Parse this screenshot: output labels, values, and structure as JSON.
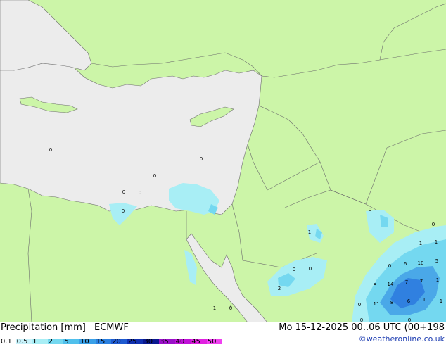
{
  "map": {
    "colors": {
      "sea": "#ececec",
      "land": "#ccf5a8",
      "precip_light": "#a8eef5",
      "precip_medium": "#74d8f0",
      "precip_heavy": "#4aa8e8",
      "precip_max": "#3080e0",
      "borders": "#6c6c6c"
    },
    "labels": [
      "0",
      "0",
      "0",
      "0",
      "0",
      "0",
      "0",
      "0",
      "1",
      "0",
      "0",
      "2",
      "1",
      "1",
      "1",
      "0",
      "0",
      "0",
      "6",
      "10",
      "5",
      "1",
      "8",
      "14",
      "7",
      "7",
      "1",
      "0",
      "11",
      "8",
      "6",
      "1",
      "1",
      "0"
    ]
  },
  "footer": {
    "title": "Precipitation [mm]",
    "model": "ECMWF",
    "valid_time": "Mo 15-12-2025 00..06 UTC (00+198",
    "credit": "©weatheronline.co.uk",
    "scale": [
      {
        "label": "0.1",
        "color": "#fefefe"
      },
      {
        "label": "0.5",
        "color": "#c8f2fa"
      },
      {
        "label": "1",
        "color": "#a8eef5"
      },
      {
        "label": "2",
        "color": "#74d8f0"
      },
      {
        "label": "5",
        "color": "#50c0ec"
      },
      {
        "label": "10",
        "color": "#3aa0e8"
      },
      {
        "label": "15",
        "color": "#2a80e0"
      },
      {
        "label": "20",
        "color": "#1e5ad0"
      },
      {
        "label": "25",
        "color": "#1030b0"
      },
      {
        "label": "30",
        "color": "#0a1890"
      },
      {
        "label": "35",
        "color": "#9a10c8"
      },
      {
        "label": "40",
        "color": "#c010d8"
      },
      {
        "label": "45",
        "color": "#e020e0"
      },
      {
        "label": "50",
        "color": "#f040f0"
      }
    ]
  }
}
